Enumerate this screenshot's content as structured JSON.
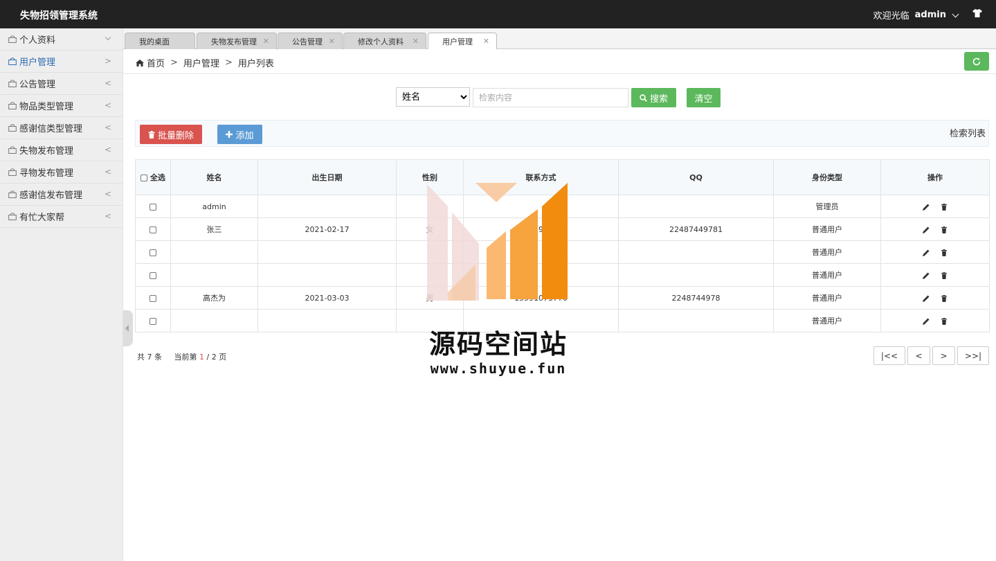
{
  "app": {
    "title": "失物招领管理系统",
    "welcome": "欢迎光临",
    "user": "admin"
  },
  "sidebar": {
    "items": [
      {
        "label": "个人资料",
        "arrow": "down"
      },
      {
        "label": "用户管理",
        "arrow": ">",
        "active": true
      },
      {
        "label": "公告管理",
        "arrow": "<"
      },
      {
        "label": "物品类型管理",
        "arrow": "<"
      },
      {
        "label": "感谢信类型管理",
        "arrow": "<"
      },
      {
        "label": "失物发布管理",
        "arrow": "<"
      },
      {
        "label": "寻物发布管理",
        "arrow": "<"
      },
      {
        "label": "感谢信发布管理",
        "arrow": "<"
      },
      {
        "label": "有忙大家帮",
        "arrow": "<"
      }
    ]
  },
  "tabs": [
    {
      "label": "我的桌面"
    },
    {
      "label": "失物发布管理"
    },
    {
      "label": "公告管理"
    },
    {
      "label": "修改个人资料"
    },
    {
      "label": "用户管理",
      "active": true
    }
  ],
  "breadcrumb": {
    "home": "首页",
    "sep": ">",
    "level1": "用户管理",
    "level2": "用户列表"
  },
  "search": {
    "field_selected": "姓名",
    "placeholder": "检索内容",
    "search_label": "搜索",
    "clear_label": "清空"
  },
  "toolbar": {
    "batch_delete_label": "批量删除",
    "add_label": "添加",
    "caption": "检索列表"
  },
  "table": {
    "select_all": "全选",
    "columns": [
      "姓名",
      "出生日期",
      "性别",
      "联系方式",
      "QQ",
      "身份类型",
      "操作"
    ],
    "rows": [
      {
        "name": "admin",
        "birth": "",
        "gender": "",
        "phone": "",
        "qq": "",
        "role": "管理员"
      },
      {
        "name": "张三",
        "birth": "2021-02-17",
        "gender": "女",
        "phone": "15987",
        "qq": "22487449781",
        "role": "普通用户"
      },
      {
        "name": "",
        "birth": "",
        "gender": "",
        "phone": "",
        "qq": "",
        "role": "普通用户"
      },
      {
        "name": "",
        "birth": "",
        "gender": "",
        "phone": "",
        "qq": "",
        "role": "普通用户"
      },
      {
        "name": "高杰为",
        "birth": "2021-03-03",
        "gender": "男",
        "phone": "15591073770",
        "qq": "2248744978",
        "role": "普通用户"
      },
      {
        "name": "",
        "birth": "",
        "gender": "",
        "phone": "",
        "qq": "",
        "role": "普通用户"
      }
    ]
  },
  "pager": {
    "total_prefix": "共",
    "total": "7",
    "total_suffix": "条",
    "current_prefix": "当前第",
    "current": "1",
    "slash": "/",
    "pages": "2",
    "pages_suffix": "页",
    "first": "|<<",
    "prev": "<",
    "next": ">",
    "last": ">>|"
  },
  "watermark": {
    "title": "源码空间站",
    "url": "www.shuyue.fun"
  },
  "colors": {
    "header_bg": "#222222",
    "green": "#5cb85c",
    "red": "#d9534f",
    "blue": "#5b9bd5",
    "orange": "#f7941d"
  }
}
